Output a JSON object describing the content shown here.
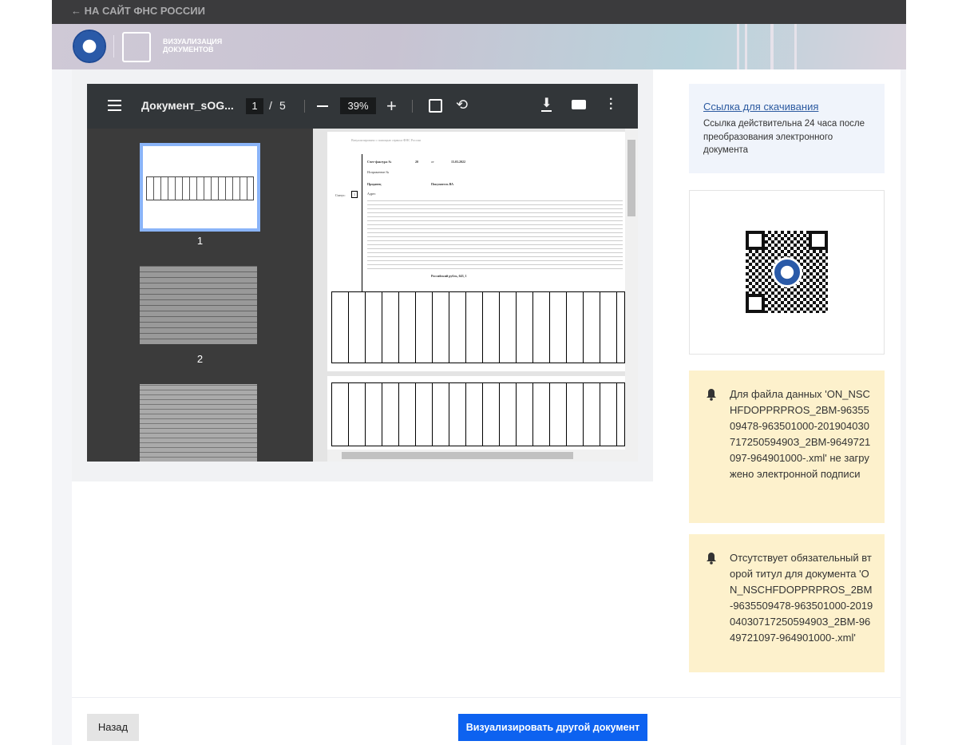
{
  "topbar": {
    "back_link": "← НА САЙТ ФНС РОССИИ"
  },
  "banner": {
    "title_line1": "ВИЗУАЛИЗАЦИЯ",
    "title_line2": "ДОКУМЕНТОВ"
  },
  "viewer": {
    "filename": "Документ_sOG...",
    "current_page": "1",
    "page_sep": "/",
    "total_pages": "5",
    "zoom": "39%",
    "thumbnails": [
      "1",
      "2"
    ]
  },
  "document": {
    "header": "Визуализировано с помощью сервиса ФНС России",
    "invoice_label": "Счет-фактура №",
    "invoice_no": "20",
    "from": "от",
    "date": "15.03.2022",
    "correction_label": "Исправление №",
    "seller_label": "Продавец",
    "seller": "Покупатель ВА",
    "address_label": "Адрес",
    "status_label": "Статус:",
    "status": "1",
    "currency": "Российский рубль, 643, 1"
  },
  "side": {
    "download_link": "Ссылка для скачивания",
    "download_note": "Ссылка действительна 24 часа после преобразования электронного документа",
    "warnings": [
      "Для файла данных 'ON_NSCHFDOPPRPROS_2BM-9635509478-963501000-20190403071725059490З_2BM-9649721097-964901000-.xml' не загружено электронной подписи",
      "Отсутствует обязательный второй титул для документа 'ON_NSCHFDOPPRPROS_2BM-9635509478-963501000-20190403071725059490З_2BM-9649721097-964901000-.xml'"
    ]
  },
  "footer": {
    "back_button": "Назад",
    "visualize_button": "Визуализировать другой документ"
  },
  "colors": {
    "primary": "#0d62f0",
    "warning_bg": "#fdf1cc",
    "toolbar": "#323639"
  }
}
